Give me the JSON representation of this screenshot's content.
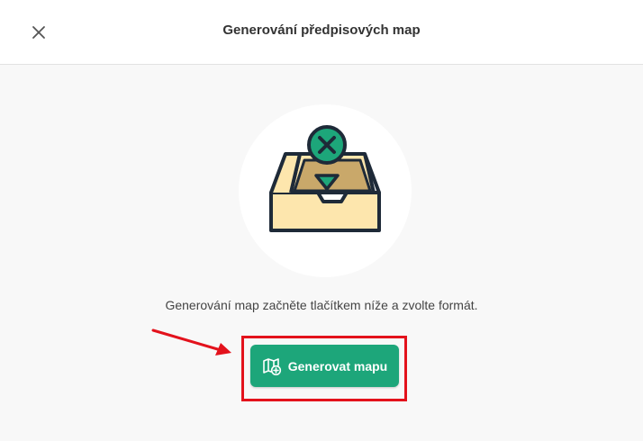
{
  "dialog": {
    "title": "Generování předpisových map"
  },
  "empty_state": {
    "message": "Generování map začněte tlačítkem níže a zvolte formát.",
    "illustration_icon": "empty-inbox-tray-with-x-pin-icon"
  },
  "actions": {
    "generate_label": "Generovat mapu",
    "generate_icon": "map-plus-icon"
  },
  "colors": {
    "accent": "#1da67a",
    "annotation": "#e3121c",
    "tray_fill": "#fde6ad",
    "tray_inner": "#c9a86a",
    "outline": "#1e2a38"
  }
}
